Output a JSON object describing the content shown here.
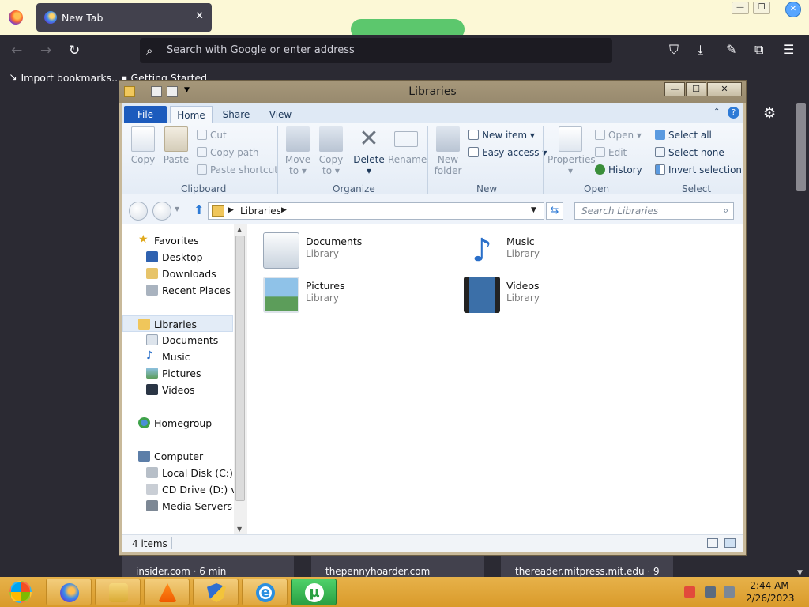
{
  "browser": {
    "tab_title": "New Tab",
    "tab_close": "✕",
    "url_placeholder": "Search with Google or enter address",
    "bookmarks": [
      {
        "label": "Import bookmarks..."
      },
      {
        "label": "Getting Started"
      }
    ],
    "cards": [
      {
        "label": "insider.com · 6 min"
      },
      {
        "label": "thepennyhoarder.com"
      },
      {
        "label": "thereader.mitpress.mit.edu · 9"
      }
    ]
  },
  "explorer": {
    "title": "Libraries",
    "ribbon_tabs": [
      "File",
      "Home",
      "Share",
      "View"
    ],
    "clipboard": {
      "label": "Clipboard",
      "copy": "Copy",
      "paste": "Paste",
      "cut": "Cut",
      "copy_path": "Copy path",
      "paste_shortcut": "Paste shortcut"
    },
    "organize": {
      "label": "Organize",
      "move_to": "Move",
      "move_to_2": "to",
      "copy_to": "Copy",
      "copy_to_2": "to",
      "delete": "Delete",
      "rename": "Rename"
    },
    "new": {
      "label": "New",
      "new_folder": "New",
      "new_folder_2": "folder",
      "new_item": "New item",
      "easy_access": "Easy access"
    },
    "open": {
      "label": "Open",
      "properties": "Properties",
      "open": "Open",
      "edit": "Edit",
      "history": "History"
    },
    "select": {
      "label": "Select",
      "select_all": "Select all",
      "select_none": "Select none",
      "invert_selection": "Invert selection"
    },
    "address": {
      "path": "Libraries",
      "search_placeholder": "Search Libraries"
    },
    "nav": {
      "favorites": "Favorites",
      "desktop": "Desktop",
      "downloads": "Downloads",
      "recent_places": "Recent Places",
      "libraries": "Libraries",
      "documents": "Documents",
      "music": "Music",
      "pictures": "Pictures",
      "videos": "Videos",
      "homegroup": "Homegroup",
      "computer": "Computer",
      "local_disk": "Local Disk (C:)",
      "cd_drive": "CD Drive (D:) virt",
      "media_servers": "Media Servers"
    },
    "libraries": [
      {
        "name": "Documents",
        "type": "Library"
      },
      {
        "name": "Music",
        "type": "Library"
      },
      {
        "name": "Pictures",
        "type": "Library"
      },
      {
        "name": "Videos",
        "type": "Library"
      }
    ],
    "status": "4 items"
  },
  "taskbar": {
    "time": "2:44 AM",
    "date": "2/26/2023"
  }
}
